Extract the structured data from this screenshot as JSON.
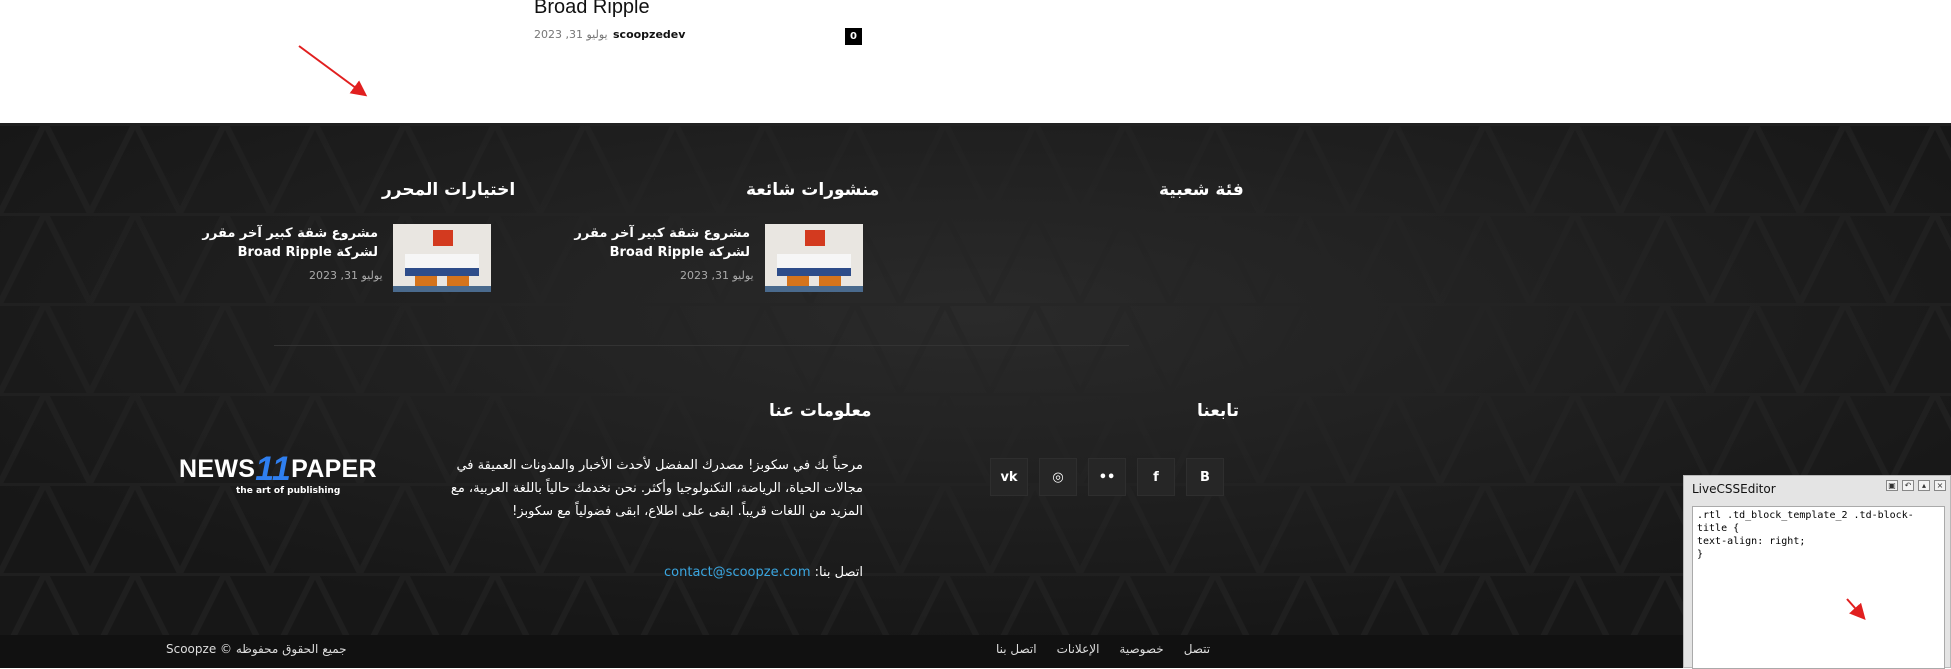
{
  "top_post": {
    "title_partial": "Broad Ripple",
    "author": "scoopzedev",
    "date": "يوليو 31, 2023",
    "comments": "0"
  },
  "footer": {
    "sections": {
      "popular_category": "فئة شعبية",
      "popular_posts": "منشورات شائعة",
      "editor_picks": "اختيارات المحرر",
      "follow_us": "تابعنا",
      "about_us": "معلومات عنا"
    },
    "popular_posts": [
      {
        "title": "مشروع شقة كبير آخر مقرر لشركة Broad Ripple",
        "date": "يوليو 31, 2023"
      }
    ],
    "editor_picks": [
      {
        "title": "مشروع شقة كبير آخر مقرر لشركة Broad Ripple",
        "date": "يوليو 31, 2023"
      }
    ],
    "social": [
      {
        "label": "B",
        "icon": "blogger-icon"
      },
      {
        "label": "f",
        "icon": "facebook-icon"
      },
      {
        "label": "••",
        "icon": "flickr-icon"
      },
      {
        "label": "◎",
        "icon": "instagram-icon"
      },
      {
        "label": "vk",
        "icon": "vk-icon"
      }
    ],
    "about_text": "مرحباً بك في سكوبز! مصدرك المفضل لأحدث الأخبار والمدونات العميقة في مجالات الحياة، الرياضة، التكنولوجيا وأكثر. نحن نخدمك حالياً باللغة العربية، مع المزيد من اللغات قريباً. ابقى على اطلاع، ابقى فضولياً مع سكوبز!",
    "contact_label": "اتصل بنا:",
    "contact_email": "contact@scoopze.com",
    "logo": {
      "left": "NEWS",
      "number": "11",
      "right": "PAPER",
      "tagline": "the art of publishing"
    },
    "copyright": "جميع الحقوق محفوظه © Scoopze",
    "bottom_nav": [
      "تتصل",
      "خصوصية",
      "الإعلانات",
      "اتصل بنا"
    ]
  },
  "live_css_editor": {
    "title": "LiveCSSEditor",
    "code": ".rtl .td_block_template_2 .td-block-title {\ntext-align: right;\n}"
  },
  "colors": {
    "footer_bg": "#1b1b1b",
    "accent_blue": "#3aa6e0",
    "annotation_red": "#e11f1f"
  }
}
